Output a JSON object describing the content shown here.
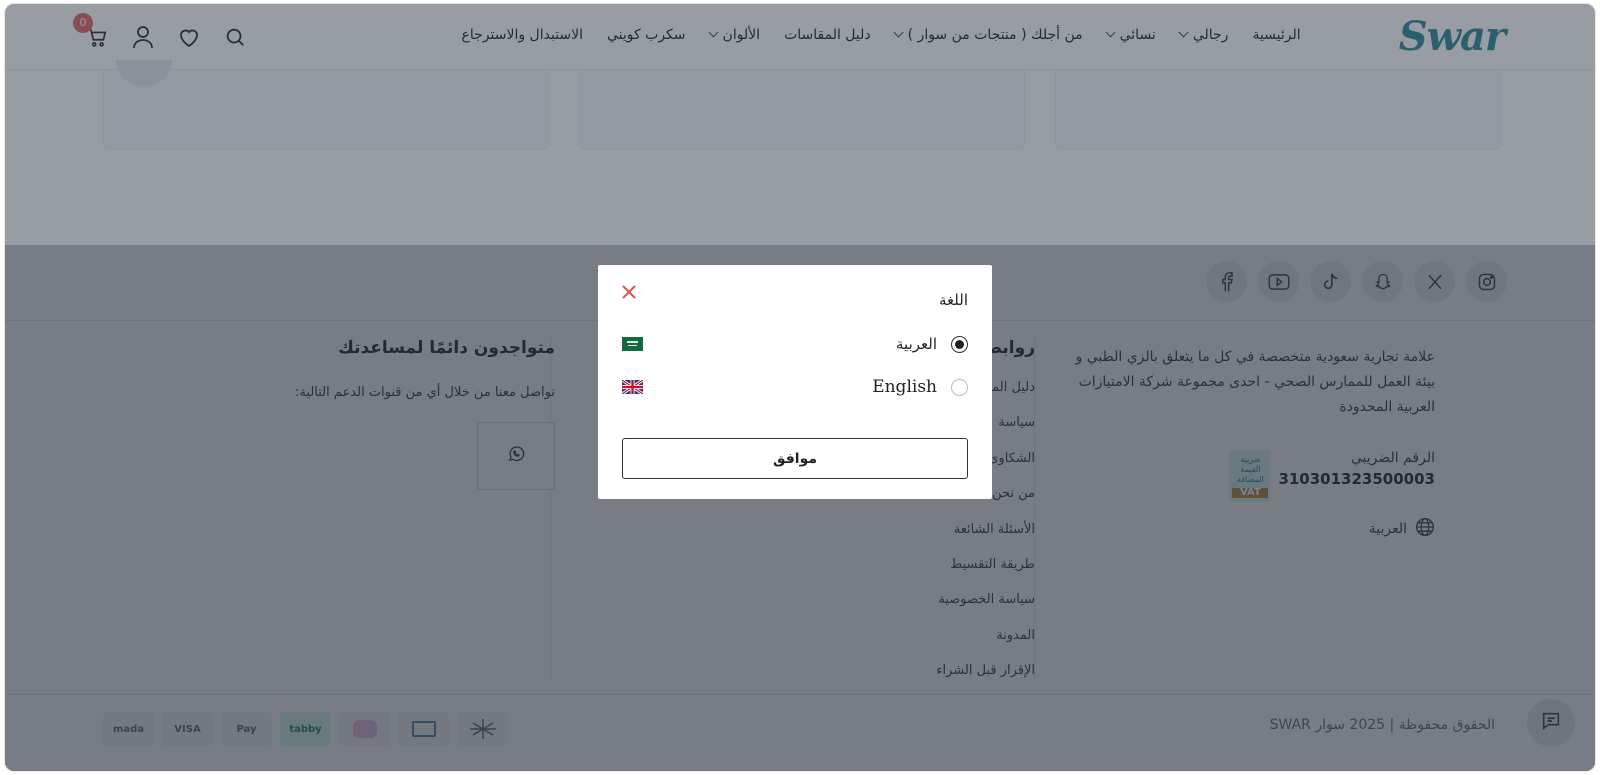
{
  "header": {
    "logo": "Swar",
    "nav": [
      {
        "label": "الرئيسية",
        "dropdown": false
      },
      {
        "label": "رجالي",
        "dropdown": true
      },
      {
        "label": "نسائي",
        "dropdown": true
      },
      {
        "label": "من أجلك ( منتجات من سوار )",
        "dropdown": true
      },
      {
        "label": "دليل المقاسات",
        "dropdown": false
      },
      {
        "label": "الألوان",
        "dropdown": true
      },
      {
        "label": "سكرب كويني",
        "dropdown": false
      },
      {
        "label": "الاستبدال والاسترجاع",
        "dropdown": false
      }
    ],
    "cart_count": "0"
  },
  "footer": {
    "social": [
      "instagram-icon",
      "x-icon",
      "snapchat-icon",
      "tiktok-icon",
      "youtube-icon",
      "facebook-icon"
    ],
    "about": "علامة تجارية سعودية متخصصة في كل ما يتعلق بالزي الطبي و بيئة العمل للممارس الصحي - احدى مجموعة شركة الامتيازات العربية المحدودة",
    "vat_label": "الرقم الضريبي",
    "vat_number": "310301323500003",
    "language": "العربية",
    "links_title": "روابط",
    "links": [
      "دليل المقاسات",
      "سياسة",
      "الشكاوى",
      "من نحن",
      "الأسئلة الشائعة",
      "طريقة التقسيط",
      "سياسة الخصوصية",
      "المدونة",
      "الإقرار قبل الشراء"
    ],
    "support_title": "متواجدون دائمًا لمساعدتك",
    "support_text": "تواصل معنا من خلال أي من قنوات الدعم التالية:",
    "copyright": "الحقوق محفوظة | 2025 سوار SWAR",
    "payments": [
      "mada",
      "VISA",
      "Pay",
      "tabby",
      "tamara",
      "bank",
      "stc"
    ]
  },
  "modal": {
    "title": "اللغة",
    "options": [
      {
        "label": "العربية",
        "selected": true,
        "flag": "sa-flag"
      },
      {
        "label": "English",
        "selected": false,
        "flag": "uk-flag"
      }
    ],
    "confirm_label": "موافق"
  },
  "colors": {
    "brand": "#2f8a9a",
    "overlay": "rgba(40,48,62,0.48)",
    "close": "#d9534f"
  }
}
